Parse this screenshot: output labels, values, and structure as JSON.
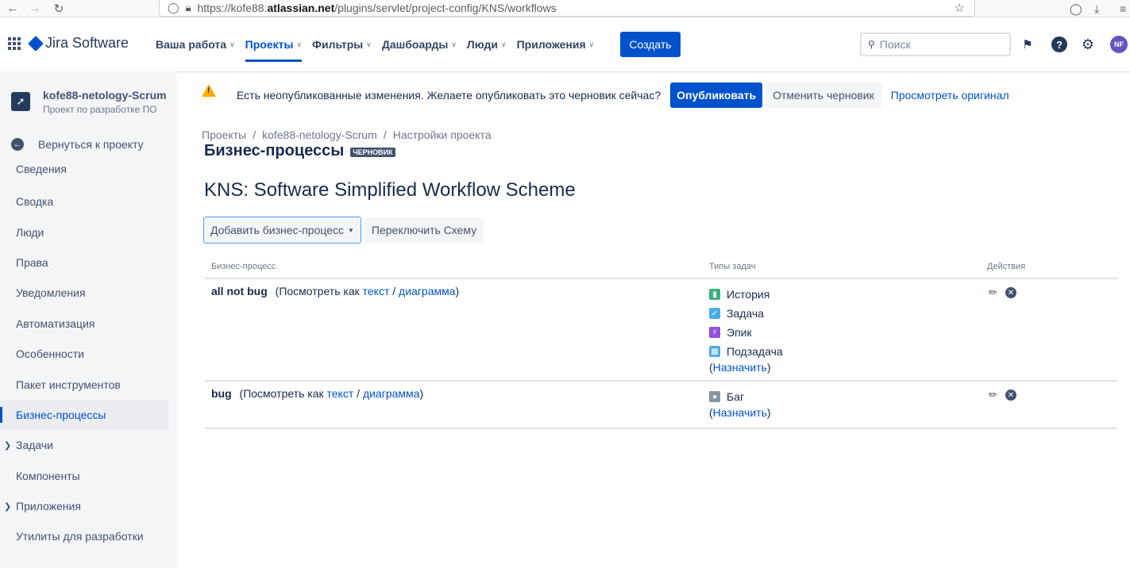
{
  "browser": {
    "url_prefix": "https://kofe88.",
    "url_domain": "atlassian.net",
    "url_path": "/plugins/servlet/project-config/KNS/workflows"
  },
  "topnav": {
    "product": "Jira Software",
    "items": [
      {
        "label": "Ваша работа",
        "active": false
      },
      {
        "label": "Проекты",
        "active": true
      },
      {
        "label": "Фильтры",
        "active": false
      },
      {
        "label": "Дашбоарды",
        "active": false
      },
      {
        "label": "Люди",
        "active": false
      },
      {
        "label": "Приложения",
        "active": false
      }
    ],
    "create_label": "Создать",
    "search_placeholder": "Поиск",
    "avatar_initials": "NF"
  },
  "sidebar": {
    "project_name": "kofe88-netology-Scrum",
    "project_type": "Проект по разработке ПО",
    "back_label": "Вернуться к проекту",
    "items": [
      {
        "label": "Сведения"
      },
      {
        "label": "Сводка"
      },
      {
        "label": "Люди"
      },
      {
        "label": "Права"
      },
      {
        "label": "Уведомления"
      },
      {
        "label": "Автоматизация"
      },
      {
        "label": "Особенности"
      },
      {
        "label": "Пакет инструментов"
      },
      {
        "label": "Бизнес-процессы"
      },
      {
        "label": "Задачи"
      },
      {
        "label": "Компоненты"
      },
      {
        "label": "Приложения"
      },
      {
        "label": "Утилиты для разработки"
      }
    ]
  },
  "banner": {
    "text": "Есть неопубликованные изменения. Желаете опубликовать это черновик сейчас?",
    "publish_label": "Опубликовать",
    "discard_label": "Отменить черновик",
    "view_original_label": "Просмотреть оригинал"
  },
  "breadcrumbs": [
    "Проекты",
    "kofe88-netology-Scrum",
    "Настройки проекта"
  ],
  "breadcrumb_sep": "/",
  "page_title": "Бизнес-процессы",
  "draft_lozenge": "ЧЕРНОВИК",
  "scheme_title": "KNS: Software Simplified Workflow Scheme",
  "toolbar": {
    "add_workflow_label": "Добавить бизнес-процесс",
    "switch_scheme_label": "Переключить Схему"
  },
  "table": {
    "headers": {
      "workflow": "Бизнес-процесс",
      "issue_types": "Типы задач",
      "actions": "Действия"
    },
    "view_as": "(Посмотреть как",
    "text_link": "текст",
    "slash": "/",
    "diagram_link": "диаграмма",
    "close_paren": ")",
    "assign_open": "(",
    "assign_link": "Назначить",
    "assign_close": ")",
    "rows": [
      {
        "name": "all not bug",
        "issue_types": [
          {
            "label": "История",
            "color": "#36b37e",
            "icon": "story-icon"
          },
          {
            "label": "Задача",
            "color": "#4bade8",
            "icon": "task-icon"
          },
          {
            "label": "Эпик",
            "color": "#904ee2",
            "icon": "epic-icon"
          },
          {
            "label": "Подзадача",
            "color": "#4bade8",
            "icon": "subtask-icon"
          }
        ]
      },
      {
        "name": "bug",
        "issue_types": [
          {
            "label": "Баг",
            "color": "#8993a4",
            "icon": "bug-icon"
          }
        ]
      }
    ]
  }
}
